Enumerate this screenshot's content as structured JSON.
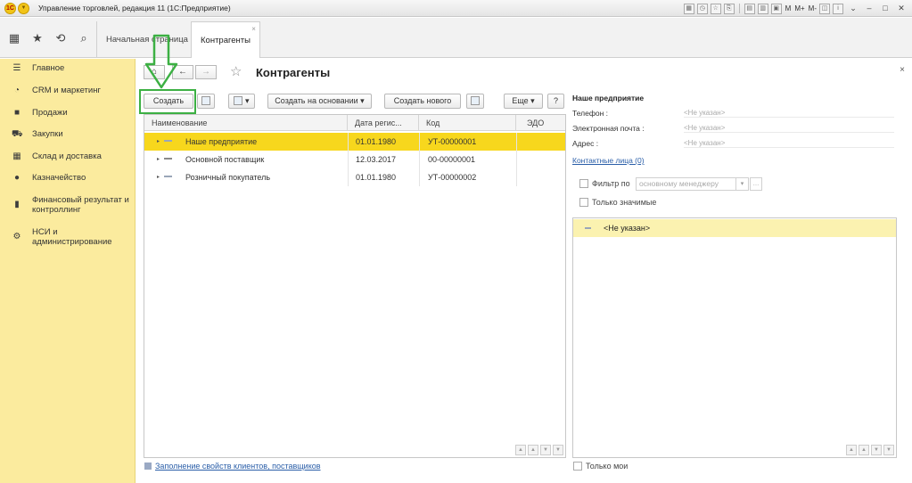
{
  "window": {
    "title": "Управление торговлей, редакция 11  (1С:Предприятие)",
    "toolbar_texts": [
      "M",
      "M+",
      "M-"
    ]
  },
  "tabs": [
    {
      "label": "Начальная страница"
    },
    {
      "label": "Контрагенты",
      "close": "×"
    }
  ],
  "sidebar": {
    "items": [
      {
        "label": "Главное",
        "icon": "hamburger-icon"
      },
      {
        "label": "CRM и маркетинг",
        "icon": "pie-chart-icon"
      },
      {
        "label": "Продажи",
        "icon": "bag-icon"
      },
      {
        "label": "Закупки",
        "icon": "cart-icon"
      },
      {
        "label": "Склад и доставка",
        "icon": "warehouse-icon"
      },
      {
        "label": "Казначейство",
        "icon": "coin-icon"
      },
      {
        "label": "Финансовый результат и контроллинг",
        "icon": "bar-chart-icon"
      },
      {
        "label": "НСИ и администрирование",
        "icon": "gear-icon"
      }
    ]
  },
  "page": {
    "title": "Контрагенты",
    "close": "×"
  },
  "toolbar": {
    "create": "Создать",
    "create_based_on": "Создать на основании",
    "create_new": "Создать нового",
    "more": "Еще",
    "help": "?"
  },
  "table": {
    "columns": [
      "Наименование",
      "Дата регис...",
      "Код",
      "ЭДО"
    ],
    "rows": [
      {
        "name": "Наше предприятие",
        "date": "01.01.1980",
        "code": "УТ-00000001",
        "edo": ""
      },
      {
        "name": "Основной поставщик",
        "date": "12.03.2017",
        "code": "00-00000001",
        "edo": ""
      },
      {
        "name": "Розничный покупатель",
        "date": "01.01.1980",
        "code": "УТ-00000002",
        "edo": ""
      }
    ]
  },
  "bottom_link": "Заполнение свойств клиентов, поставщиков",
  "details": {
    "title": "Наше предприятие",
    "phone_label": "Телефон :",
    "phone_value": "<Не указан>",
    "email_label": "Электронная почта :",
    "email_value": "<Не указан>",
    "address_label": "Адрес :",
    "address_value": "<Не указан>",
    "contacts_link": "Контактные лица (0)",
    "filter_label": "Фильтр по",
    "filter_value": "основному менеджеру",
    "only_significant": "Только значимые",
    "list_item": "<Не указан>",
    "only_mine": "Только мои"
  },
  "colors": {
    "sidebar_bg": "#fbeb9e",
    "selected_row": "#f7d71d",
    "link": "#2a5ea8",
    "highlight": "#3cb043"
  }
}
